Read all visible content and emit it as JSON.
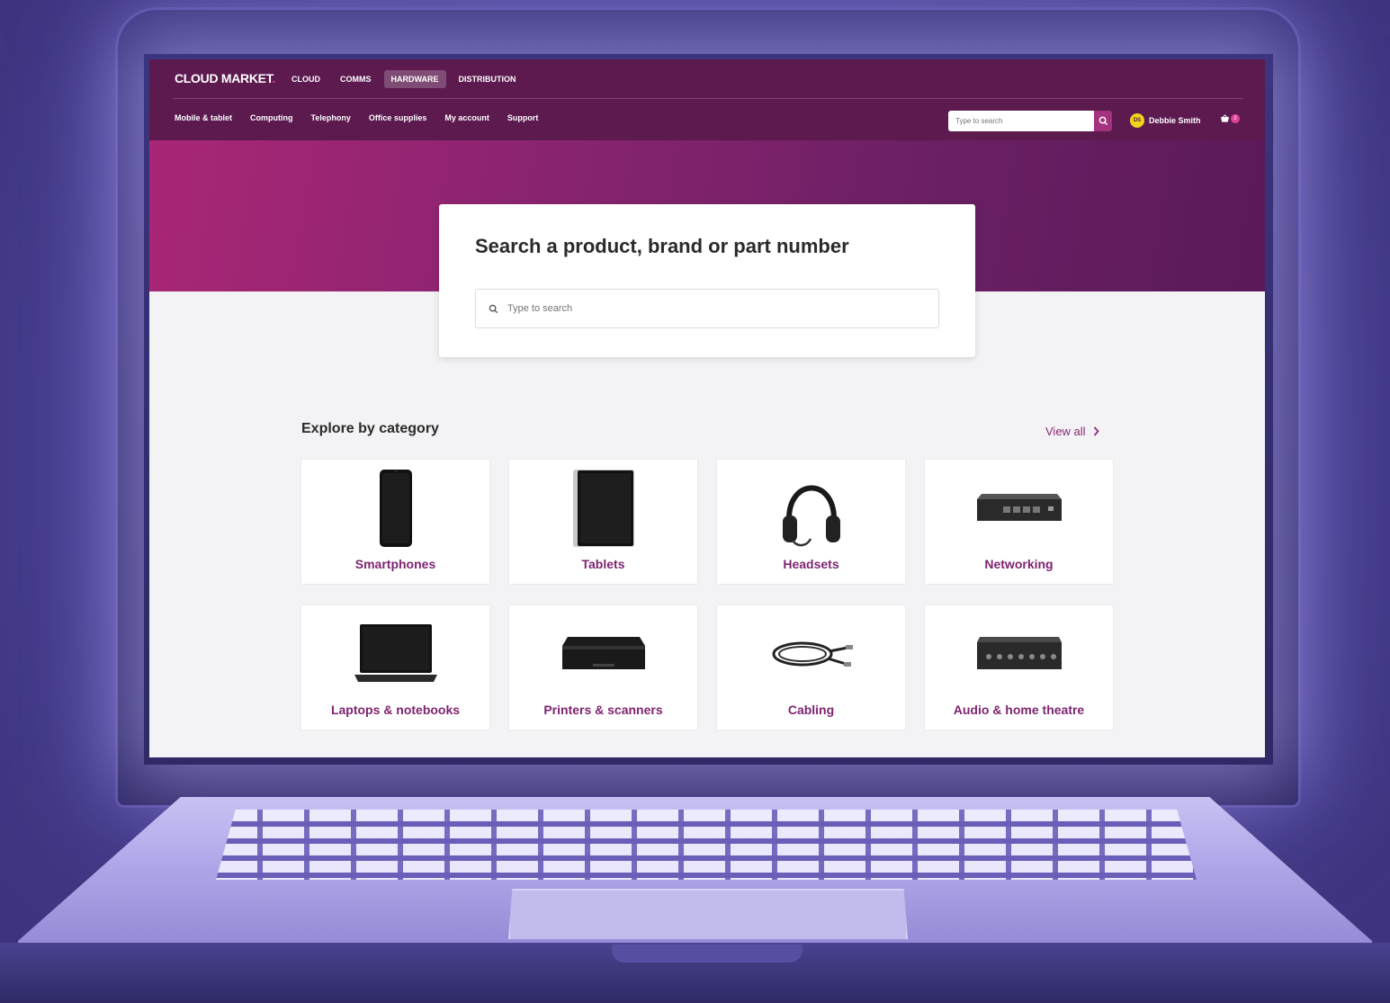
{
  "header": {
    "brand": "CLOUD MARKET",
    "brand_dot": ".",
    "main_nav": [
      "CLOUD",
      "COMMS",
      "HARDWARE",
      "DISTRIBUTION"
    ],
    "active_main_nav": "HARDWARE",
    "sub_nav": [
      "Mobile & tablet",
      "Computing",
      "Telephony",
      "Office supplies",
      "My account",
      "Support"
    ],
    "search_placeholder": "Type to search",
    "user": {
      "initials": "DS",
      "name": "Debbie Smith"
    },
    "cart_count": "2"
  },
  "hero": {
    "title": "Search a product, brand or part number",
    "search_placeholder": "Type to search"
  },
  "categories": {
    "title": "Explore by category",
    "view_all": "View all",
    "items": [
      {
        "label": "Smartphones",
        "icon": "smartphone-icon"
      },
      {
        "label": "Tablets",
        "icon": "tablet-icon"
      },
      {
        "label": "Headsets",
        "icon": "headset-icon"
      },
      {
        "label": "Networking",
        "icon": "network-switch-icon"
      },
      {
        "label": "Laptops & notebooks",
        "icon": "laptop-icon"
      },
      {
        "label": "Printers & scanners",
        "icon": "printer-icon"
      },
      {
        "label": "Cabling",
        "icon": "cable-icon"
      },
      {
        "label": "Audio & home theatre",
        "icon": "audio-receiver-icon"
      }
    ]
  },
  "colors": {
    "header_bg": "#5c1a4f",
    "accent": "#a3337e",
    "label": "#7e2470",
    "badge": "#e0409a",
    "avatar": "#f2d31b"
  }
}
